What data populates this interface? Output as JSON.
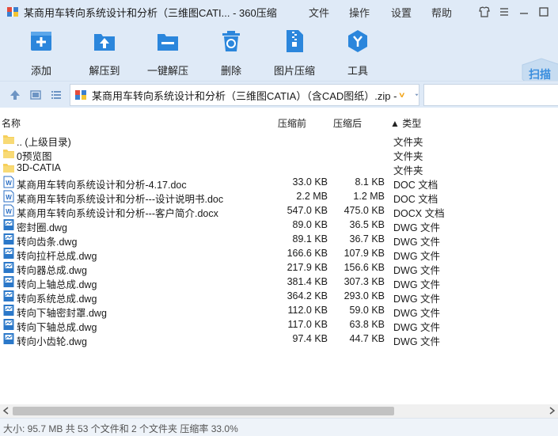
{
  "window": {
    "title": "某商用车转向系统设计和分析（三维图CATI... - 360压缩",
    "menu": [
      "文件",
      "操作",
      "设置",
      "帮助"
    ]
  },
  "toolbar": {
    "add": "添加",
    "extract_to": "解压到",
    "one_click": "一键解压",
    "delete": "删除",
    "image_compress": "图片压缩",
    "tools": "工具",
    "scan": "扫描"
  },
  "address": {
    "path": "某商用车转向系统设计和分析（三维图CATIA）（含CAD图纸）.zip -"
  },
  "columns": {
    "name": "名称",
    "size": "压缩前",
    "packed": "压缩后",
    "type": "▲ 类型"
  },
  "files": [
    {
      "name": ".. (上级目录)",
      "size": "",
      "packed": "",
      "type": "文件夹",
      "icon": "folder-icon"
    },
    {
      "name": "0预览图",
      "size": "",
      "packed": "",
      "type": "文件夹",
      "icon": "folder-icon"
    },
    {
      "name": "3D-CATIA",
      "size": "",
      "packed": "",
      "type": "文件夹",
      "icon": "folder-icon"
    },
    {
      "name": "某商用车转向系统设计和分析-4.17.doc",
      "size": "33.0 KB",
      "packed": "8.1 KB",
      "type": "DOC 文档",
      "icon": "word-doc-icon"
    },
    {
      "name": "某商用车转向系统设计和分析---设计说明书.doc",
      "size": "2.2 MB",
      "packed": "1.2 MB",
      "type": "DOC 文档",
      "icon": "word-doc-icon"
    },
    {
      "name": "某商用车转向系统设计和分析---客户简介.docx",
      "size": "547.0 KB",
      "packed": "475.0 KB",
      "type": "DOCX 文档",
      "icon": "word-doc-icon"
    },
    {
      "name": "密封圈.dwg",
      "size": "89.0 KB",
      "packed": "36.5 KB",
      "type": "DWG 文件",
      "icon": "dwg-file-icon"
    },
    {
      "name": "转向齿条.dwg",
      "size": "89.1 KB",
      "packed": "36.7 KB",
      "type": "DWG 文件",
      "icon": "dwg-file-icon"
    },
    {
      "name": "转向拉杆总成.dwg",
      "size": "166.6 KB",
      "packed": "107.9 KB",
      "type": "DWG 文件",
      "icon": "dwg-file-icon"
    },
    {
      "name": "转向器总成.dwg",
      "size": "217.9 KB",
      "packed": "156.6 KB",
      "type": "DWG 文件",
      "icon": "dwg-file-icon"
    },
    {
      "name": "转向上轴总成.dwg",
      "size": "381.4 KB",
      "packed": "307.3 KB",
      "type": "DWG 文件",
      "icon": "dwg-file-icon"
    },
    {
      "name": "转向系统总成.dwg",
      "size": "364.2 KB",
      "packed": "293.0 KB",
      "type": "DWG 文件",
      "icon": "dwg-file-icon"
    },
    {
      "name": "转向下轴密封罩.dwg",
      "size": "112.0 KB",
      "packed": "59.0 KB",
      "type": "DWG 文件",
      "icon": "dwg-file-icon"
    },
    {
      "name": "转向下轴总成.dwg",
      "size": "117.0 KB",
      "packed": "63.8 KB",
      "type": "DWG 文件",
      "icon": "dwg-file-icon"
    },
    {
      "name": "转向小齿轮.dwg",
      "size": "97.4 KB",
      "packed": "44.7 KB",
      "type": "DWG 文件",
      "icon": "dwg-file-icon"
    }
  ],
  "status": {
    "text": "大小: 95.7 MB 共 53 个文件和 2 个文件夹 压缩率 33.0%"
  },
  "colors": {
    "chrome_bg": "#dfeaf7",
    "accent_blue": "#2b86dc",
    "folder_yellow": "#f6cf5b",
    "vshield_orange": "#f2a417"
  }
}
